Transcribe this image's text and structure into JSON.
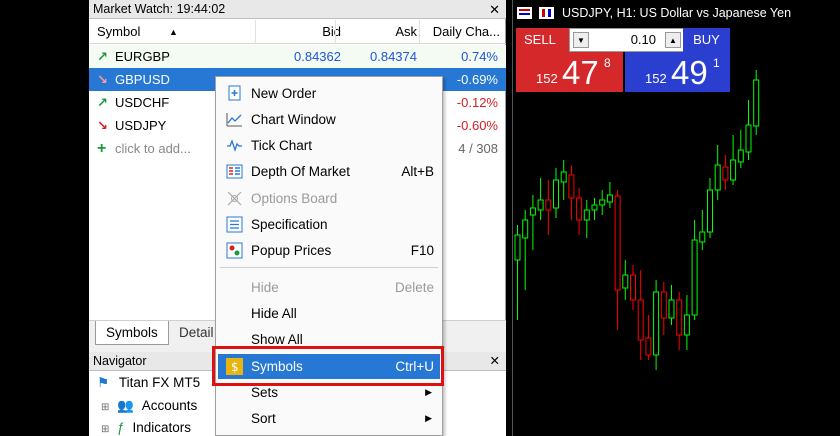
{
  "market_watch": {
    "title": "Market Watch: 19:44:02",
    "columns": {
      "symbol": "Symbol",
      "bid": "Bid",
      "ask": "Ask",
      "daily_change": "Daily Cha..."
    },
    "rows": [
      {
        "symbol": "EURGBP",
        "bid": "0.84362",
        "ask": "0.84374",
        "change": "0.74%",
        "direction": "up"
      },
      {
        "symbol": "GBPUSD",
        "bid": "",
        "ask": "",
        "change": "-0.69%",
        "direction": "down"
      },
      {
        "symbol": "USDCHF",
        "bid": "",
        "ask": "",
        "change": "-0.12%",
        "direction": "up"
      },
      {
        "symbol": "USDJPY",
        "bid": "",
        "ask": "",
        "change": "-0.60%",
        "direction": "down"
      }
    ],
    "add_row": {
      "label": "click to add...",
      "count": "4 / 308"
    },
    "tabs": {
      "symbols": "Symbols",
      "details": "Detail"
    }
  },
  "navigator": {
    "title": "Navigator",
    "root": "Titan FX MT5",
    "items": [
      "Accounts",
      "Indicators"
    ]
  },
  "context_menu": {
    "items": [
      {
        "label": "New Order",
        "shortcut": "",
        "icon": "new-order-icon",
        "disabled": false
      },
      {
        "label": "Chart Window",
        "shortcut": "",
        "icon": "chart-window-icon",
        "disabled": false
      },
      {
        "label": "Tick Chart",
        "shortcut": "",
        "icon": "tick-chart-icon",
        "disabled": false
      },
      {
        "label": "Depth Of Market",
        "shortcut": "Alt+B",
        "icon": "depth-of-market-icon",
        "disabled": false
      },
      {
        "label": "Options Board",
        "shortcut": "",
        "icon": "options-board-icon",
        "disabled": true
      },
      {
        "label": "Specification",
        "shortcut": "",
        "icon": "specification-icon",
        "disabled": false
      },
      {
        "label": "Popup Prices",
        "shortcut": "F10",
        "icon": "popup-prices-icon",
        "disabled": false
      },
      {
        "label": "Hide",
        "shortcut": "Delete",
        "icon": "",
        "disabled": true
      },
      {
        "label": "Hide All",
        "shortcut": "",
        "icon": "",
        "disabled": false
      },
      {
        "label": "Show All",
        "shortcut": "",
        "icon": "",
        "disabled": false
      },
      {
        "label": "Symbols",
        "shortcut": "Ctrl+U",
        "icon": "symbols-icon",
        "disabled": false,
        "highlighted": true
      },
      {
        "label": "Sets",
        "shortcut": "",
        "icon": "",
        "disabled": false,
        "submenu": true
      },
      {
        "label": "Sort",
        "shortcut": "",
        "icon": "",
        "disabled": false,
        "submenu": true
      }
    ]
  },
  "chart": {
    "title": "USDJPY, H1:  US Dollar vs Japanese Yen",
    "sell_label": "SELL",
    "buy_label": "BUY",
    "volume": "0.10",
    "sell_price": {
      "small": "152",
      "big": "47",
      "sup": "8"
    },
    "buy_price": {
      "small": "152",
      "big": "49",
      "sup": "1"
    }
  },
  "colors": {
    "selection": "#2678d4",
    "up": "#1a9a3a",
    "down": "#d42020",
    "sell": "#d4282a",
    "buy": "#2a3fd0",
    "bull_candle": "#00ff00",
    "bear_candle": "#ff0000",
    "highlight_box": "#e01010"
  }
}
